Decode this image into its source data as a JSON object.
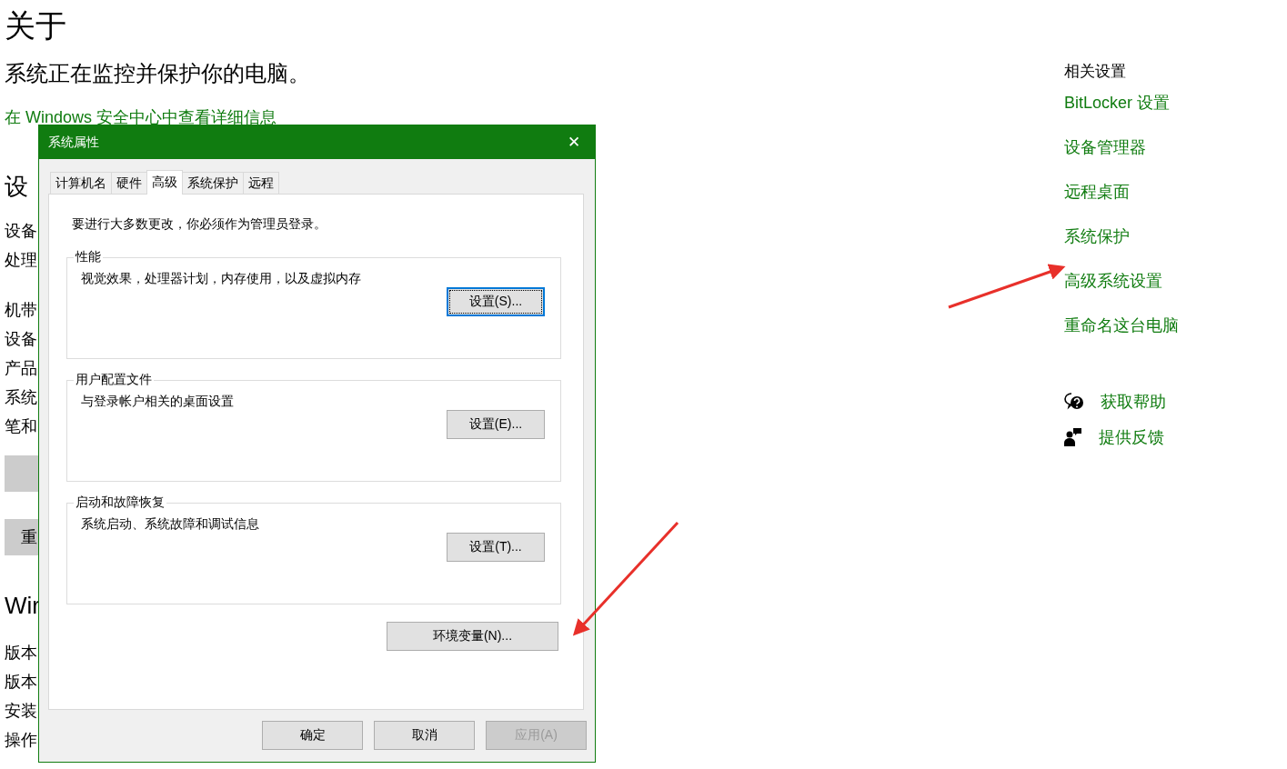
{
  "page": {
    "title": "关于",
    "status": "系统正在监控并保护你的电脑。",
    "security_link": "在 Windows 安全中心中查看详细信息",
    "device_heading": "设",
    "device_rows_1": [
      "设备",
      "处理"
    ],
    "device_rows_2": [
      "机带",
      "设备",
      "产品",
      "系统",
      "笔和"
    ],
    "buttons": [
      {
        "kind": "blank"
      },
      {
        "kind": "labeled",
        "label": "重"
      }
    ],
    "windows_heading": "Wir",
    "windows_rows": [
      "版本",
      "版本",
      "安装",
      "操作"
    ]
  },
  "related": {
    "heading": "相关设置",
    "links": [
      "BitLocker 设置",
      "设备管理器",
      "远程桌面",
      "系统保护",
      "高级系统设置",
      "重命名这台电脑"
    ],
    "support": [
      {
        "kind": "help",
        "label": "获取帮助"
      },
      {
        "kind": "feedback",
        "label": "提供反馈"
      }
    ]
  },
  "dialog": {
    "title": "系统属性",
    "close": "✕",
    "tabs": [
      {
        "label": "计算机名",
        "selected": false
      },
      {
        "label": "硬件",
        "selected": false
      },
      {
        "label": "高级",
        "selected": true
      },
      {
        "label": "系统保护",
        "selected": false
      },
      {
        "label": "远程",
        "selected": false
      }
    ],
    "note": "要进行大多数更改，你必须作为管理员登录。",
    "groups": [
      {
        "title": "性能",
        "description": "视觉效果，处理器计划，内存使用，以及虚拟内存",
        "button": {
          "label": "设置(S)...",
          "focused": true
        }
      },
      {
        "title": "用户配置文件",
        "description": "与登录帐户相关的桌面设置",
        "button": {
          "label": "设置(E)...",
          "focused": false
        }
      },
      {
        "title": "启动和故障恢复",
        "description": "系统启动、系统故障和调试信息",
        "button": {
          "label": "设置(T)...",
          "focused": false
        }
      }
    ],
    "env_button": {
      "label": "环境变量(N)..."
    },
    "footer_buttons": [
      {
        "label": "确定",
        "disabled": false
      },
      {
        "label": "取消",
        "disabled": false
      },
      {
        "label": "应用(A)",
        "disabled": true
      }
    ]
  }
}
